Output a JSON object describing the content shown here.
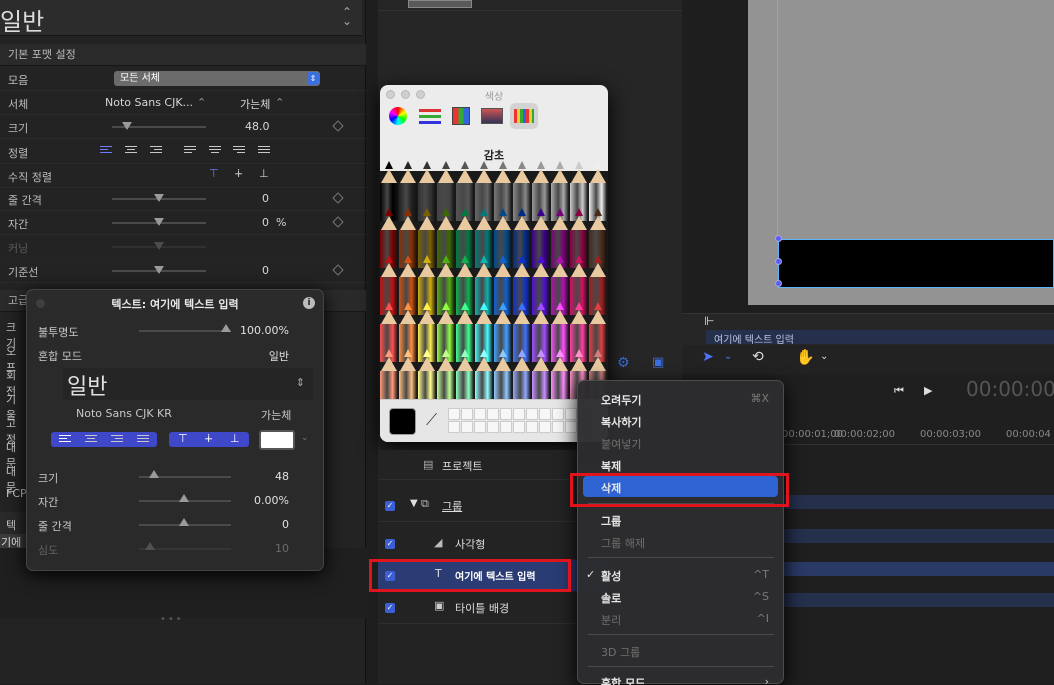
{
  "inspector": {
    "font_display": "일반",
    "section_basic": "기본 포맷 설정",
    "rows": {
      "collection": {
        "label": "모음",
        "value": "모든 서체"
      },
      "font": {
        "label": "서체",
        "value": "Noto Sans CJK...",
        "weight": "가는체"
      },
      "size": {
        "label": "크기",
        "value": "48.0",
        "level": 0.12
      },
      "align": {
        "label": "정렬"
      },
      "valign": {
        "label": "수직 정렬"
      },
      "line_spacing": {
        "label": "줄 간격",
        "value": "0"
      },
      "tracking": {
        "label": "자간",
        "value": "0",
        "unit": "%"
      },
      "kerning": {
        "label": "커닝"
      },
      "baseline": {
        "label": "기준선",
        "value": "0"
      }
    },
    "section_advanced": "고급",
    "left_labels": [
      "크기",
      "오프",
      "회전",
      "기울",
      "고정",
      "대문",
      "대문",
      "FCP"
    ],
    "text_section": "텍스",
    "text_preview": "기에"
  },
  "hud": {
    "title": "텍스트: 여기에 텍스트 입력",
    "opacity_label": "불투명도",
    "opacity_value": "100.00%",
    "opacity_level": 1.0,
    "blend_label": "혼합 모드",
    "blend_value": "일반",
    "font_display": "일반",
    "font_name": "Noto Sans CJK KR",
    "font_weight": "가는체",
    "size_label": "크기",
    "size_value": "48",
    "tracking_label": "자간",
    "tracking_value": "0.00%",
    "line_label": "줄 간격",
    "line_value": "0",
    "depth_label": "심도",
    "depth_value": "10",
    "text_color": "#ffffff"
  },
  "colors": {
    "window_title": "색상",
    "palette_name": "감초",
    "current_color": "#000000",
    "tools": [
      "color-wheel-icon",
      "color-sliders-icon",
      "color-palettes-icon",
      "image-palettes-icon",
      "pencils-icon"
    ]
  },
  "layers": {
    "project": "프로젝트",
    "items": [
      {
        "name": "그룹",
        "checked": true
      },
      {
        "name": "사각형",
        "checked": true
      },
      {
        "name": "여기에 텍스트 입력",
        "checked": true
      },
      {
        "name": "타이틀 배경",
        "checked": true
      }
    ]
  },
  "canvas": {
    "text_layer_label": "여기에 텍스트 입력",
    "timecode": "00:00:00",
    "ruler": [
      "00:00:01;00",
      "00:00:02;00",
      "00:00:03;00",
      "00:00:04"
    ]
  },
  "context_menu": {
    "items": [
      {
        "label": "오려두기",
        "key": "⌘X",
        "enabled": true
      },
      {
        "label": "복사하기",
        "key": "",
        "enabled": true
      },
      {
        "label": "붙여넣기",
        "key": "",
        "enabled": false
      },
      {
        "label": "복제",
        "key": "",
        "enabled": true
      },
      {
        "label": "삭제",
        "key": "",
        "enabled": true,
        "highlighted": true
      },
      {
        "label": "그룹",
        "key": "",
        "enabled": true
      },
      {
        "label": "그룹 해제",
        "key": "",
        "enabled": false
      },
      {
        "label": "활성",
        "key": "^T",
        "enabled": true,
        "checked": true
      },
      {
        "label": "솔로",
        "key": "^S",
        "enabled": true
      },
      {
        "label": "분리",
        "key": "^I",
        "enabled": false
      },
      {
        "label": "3D 그룹",
        "key": "",
        "enabled": false
      },
      {
        "label": "혼합 모드",
        "key": "",
        "enabled": true
      }
    ]
  },
  "colors_theme": {
    "accent": "#3c5fd6",
    "highlight": "#2f63d4",
    "annotation_red": "#e0141c"
  }
}
